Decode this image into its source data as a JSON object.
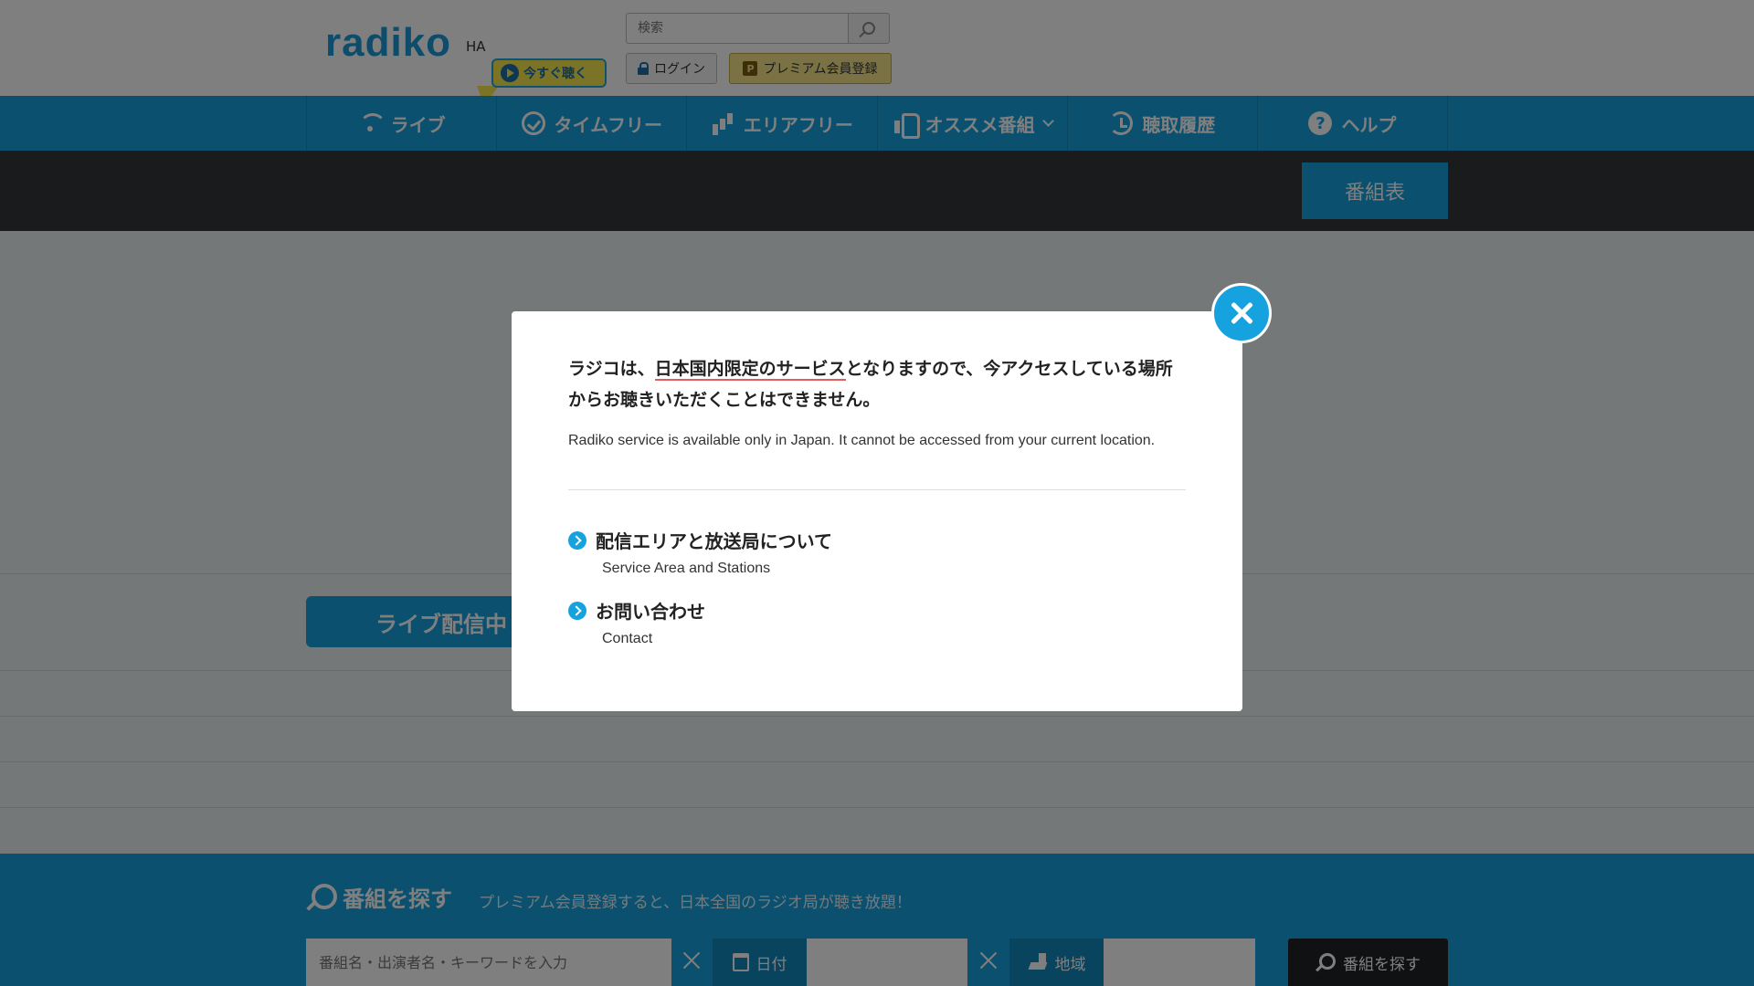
{
  "header": {
    "logo": "radiko",
    "region": "HA",
    "listen_now": "今すぐ聴く",
    "search_placeholder": "検索",
    "login_label": "ログイン",
    "premium_label": "プレミアム会員登録",
    "premium_badge": "P"
  },
  "nav": {
    "items": [
      {
        "label": "ライブ",
        "icon": "wifi-icon"
      },
      {
        "label": "タイムフリー",
        "icon": "check-circle-icon"
      },
      {
        "label": "エリアフリー",
        "icon": "bars-icon"
      },
      {
        "label": "オススメ番組",
        "icon": "thumb-up-icon"
      },
      {
        "label": "聴取履歴",
        "icon": "history-icon"
      },
      {
        "label": "ヘルプ",
        "icon": "help-icon"
      }
    ],
    "help_glyph": "?"
  },
  "toolbar": {
    "schedule_label": "番組表"
  },
  "main": {
    "live_tab_label": "ライブ配信中"
  },
  "modal": {
    "message_jp_pre": "ラジコは、",
    "message_jp_underlined": "日本国内限定のサービス",
    "message_jp_post": "となりますので、今アクセスしている場所からお聴きいただくことはできません。",
    "message_en": "Radiko service is available only in Japan. It cannot be accessed from your current location.",
    "links": [
      {
        "jp": "配信エリアと放送局について",
        "en": "Service Area and Stations"
      },
      {
        "jp": "お問い合わせ",
        "en": "Contact"
      }
    ]
  },
  "footer_search": {
    "title": "番組を探す",
    "subtitle": "プレミアム会員登録すると、日本全国のラジオ局が聴き放題！",
    "keyword_placeholder": "番組名・出演者名・キーワードを入力",
    "date_label": "日付",
    "area_label": "地域",
    "submit_label": "番組を探す"
  },
  "colors": {
    "brand": "#16a2df",
    "premium": "#f4e58a",
    "dark": "#32363a"
  }
}
